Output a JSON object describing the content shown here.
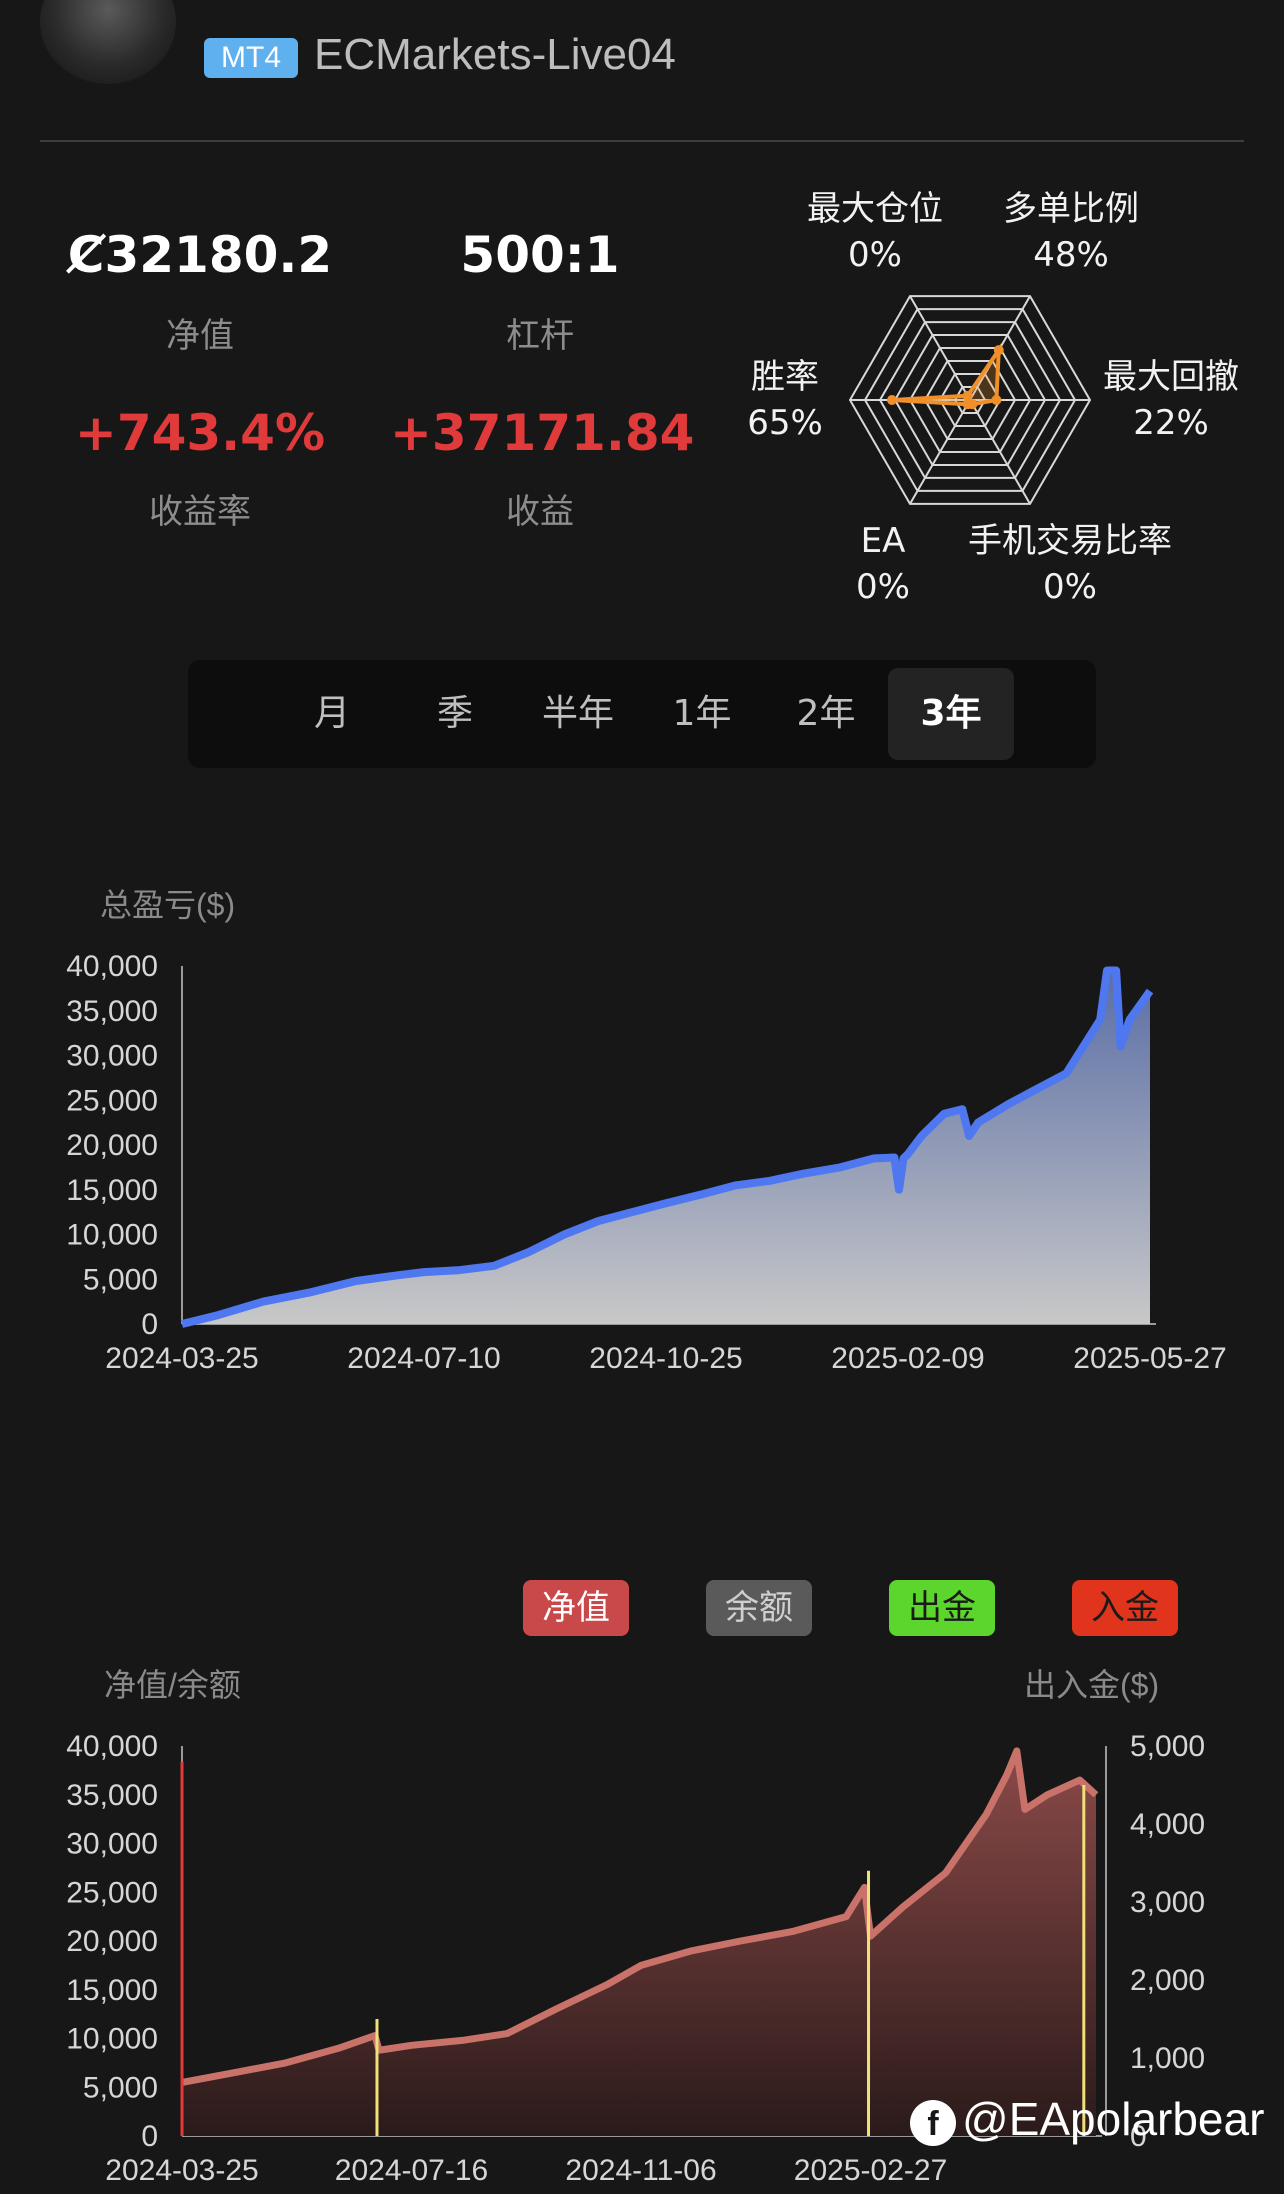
{
  "header": {
    "badge": "MT4",
    "account_name": "ECMarkets-Live04"
  },
  "stats": {
    "equity_value": "Ȼ32180.2",
    "equity_label": "净值",
    "leverage_value": "500:1",
    "leverage_label": "杠杆",
    "return_rate_value": "+743.4%",
    "return_rate_label": "收益率",
    "profit_value": "+37171.84",
    "profit_label": "收益"
  },
  "radar": {
    "max_position": {
      "label": "最大仓位",
      "value": "0%"
    },
    "multi_order": {
      "label": "多单比例",
      "value": "48%"
    },
    "max_drawdown": {
      "label": "最大回撤",
      "value": "22%"
    },
    "mobile_trade": {
      "label": "手机交易比率",
      "value": "0%"
    },
    "ea": {
      "label": "EA",
      "value": "0%"
    },
    "win_rate": {
      "label": "胜率",
      "value": "65%"
    },
    "accent_color": "#f0902a"
  },
  "tabs": [
    {
      "label": "月",
      "active": false
    },
    {
      "label": "季",
      "active": false
    },
    {
      "label": "半年",
      "active": false
    },
    {
      "label": "1年",
      "active": false
    },
    {
      "label": "2年",
      "active": false
    },
    {
      "label": "3年",
      "active": true
    }
  ],
  "legend": {
    "equity": "净值",
    "balance": "余额",
    "withdraw": "出金",
    "deposit": "入金"
  },
  "watermark": {
    "text": "@EApolarbear",
    "icon": "facebook-icon"
  },
  "chart_data": [
    {
      "type": "area",
      "title": "总盈亏($)",
      "ylim": [
        0,
        40000
      ],
      "yticks": [
        "40,000",
        "35,000",
        "30,000",
        "25,000",
        "20,000",
        "15,000",
        "10,000",
        "5,000",
        "0"
      ],
      "xticks": [
        "2024-03-25",
        "2024-07-10",
        "2024-10-25",
        "2025-02-09",
        "2025-05-27"
      ],
      "color": "#4f78f0",
      "series": [
        {
          "x": [
            "2024-03-25",
            "2024-04-10",
            "2024-04-30",
            "2024-05-20",
            "2024-06-10",
            "2024-06-30",
            "2024-07-10",
            "2024-07-25",
            "2024-08-10",
            "2024-08-25",
            "2024-09-10",
            "2024-09-25",
            "2024-10-10",
            "2024-10-25",
            "2024-11-10",
            "2024-11-25",
            "2024-12-10",
            "2024-12-25",
            "2025-01-10",
            "2025-01-25",
            "2025-02-03",
            "2025-02-05",
            "2025-02-07",
            "2025-02-09",
            "2025-02-15",
            "2025-02-25",
            "2025-03-05",
            "2025-03-08",
            "2025-03-12",
            "2025-03-25",
            "2025-04-05",
            "2025-04-20",
            "2025-04-30",
            "2025-05-05",
            "2025-05-08",
            "2025-05-12",
            "2025-05-14",
            "2025-05-18",
            "2025-05-27"
          ],
          "values": [
            0,
            1000,
            2500,
            3500,
            4800,
            5500,
            5800,
            6000,
            6500,
            8000,
            10000,
            11500,
            12500,
            13500,
            14500,
            15500,
            16000,
            16800,
            17500,
            18500,
            18600,
            15000,
            18500,
            19000,
            21000,
            23500,
            24000,
            21000,
            22500,
            24500,
            26000,
            28000,
            32000,
            34000,
            39500,
            39500,
            31000,
            34000,
            37200
          ]
        }
      ]
    },
    {
      "type": "area",
      "title": "净值/余额",
      "y2label": "出入金($)",
      "ylim": [
        0,
        40000
      ],
      "y2lim": [
        0,
        5000
      ],
      "yticks": [
        "40,000",
        "35,000",
        "30,000",
        "25,000",
        "20,000",
        "15,000",
        "10,000",
        "5,000",
        "0"
      ],
      "y2ticks": [
        "5,000",
        "4,000",
        "3,000",
        "2,000",
        "1,000",
        "0"
      ],
      "xticks": [
        "2024-03-25",
        "2024-07-16",
        "2024-11-06",
        "2025-02-27"
      ],
      "color": "#c9726a",
      "series": [
        {
          "name": "净值",
          "x": [
            "2024-03-25",
            "2024-04-20",
            "2024-05-15",
            "2024-06-10",
            "2024-06-28",
            "2024-06-30",
            "2024-07-16",
            "2024-08-10",
            "2024-09-01",
            "2024-09-25",
            "2024-10-20",
            "2024-11-06",
            "2024-12-01",
            "2024-12-25",
            "2025-01-20",
            "2025-02-15",
            "2025-02-24",
            "2025-02-27",
            "2025-03-15",
            "2025-04-05",
            "2025-04-25",
            "2025-05-05",
            "2025-05-10",
            "2025-05-14",
            "2025-05-25",
            "2025-06-10",
            "2025-06-18"
          ],
          "values": [
            5500,
            6500,
            7500,
            9000,
            10300,
            8800,
            9300,
            9800,
            10500,
            13000,
            15500,
            17500,
            19000,
            20000,
            21000,
            22500,
            25500,
            20500,
            23500,
            27000,
            33000,
            37000,
            39500,
            33500,
            35000,
            36500,
            35000
          ]
        }
      ],
      "deposits": [
        {
          "x": "2024-03-25",
          "value": 4800,
          "color": "#e03a3a"
        },
        {
          "x": "2024-06-29",
          "value": 1500,
          "color": "#f0e078"
        },
        {
          "x": "2025-02-26",
          "value": 3400,
          "color": "#f0e078"
        },
        {
          "x": "2025-06-12",
          "value": 4500,
          "color": "#f0e078"
        }
      ]
    }
  ]
}
